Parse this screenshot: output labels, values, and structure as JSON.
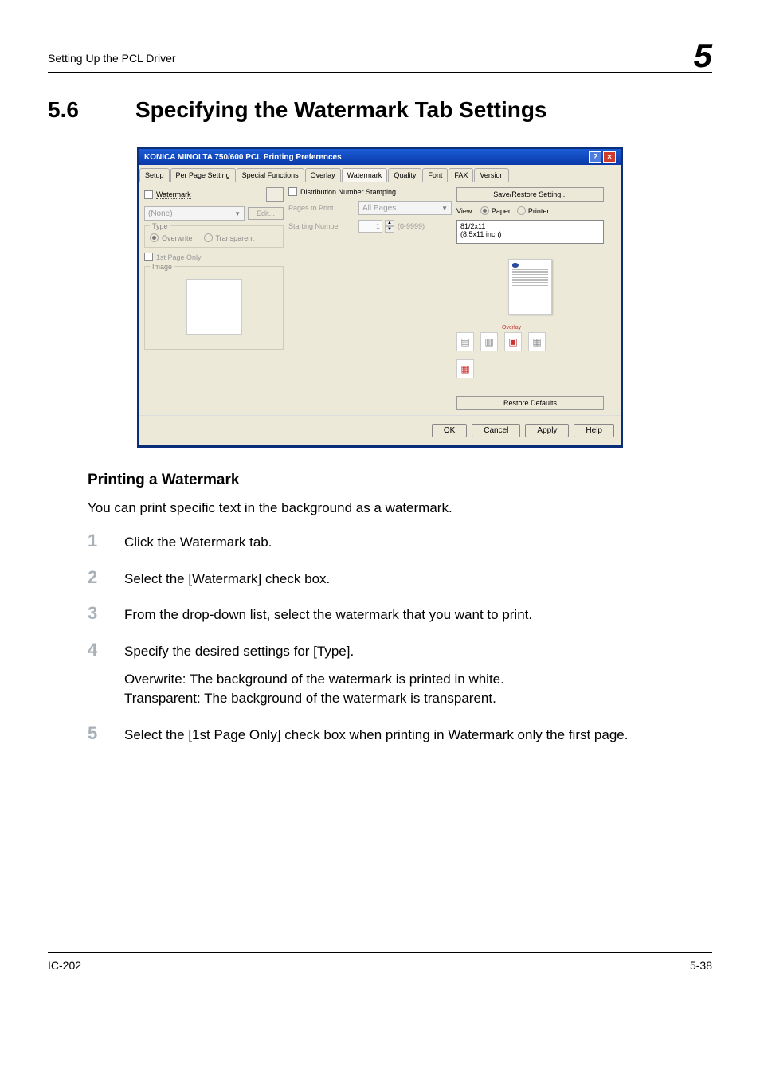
{
  "header": {
    "chapter_title": "Setting Up the PCL Driver",
    "chapter_num": "5"
  },
  "section": {
    "number": "5.6",
    "title": "Specifying the Watermark Tab Settings"
  },
  "dialog": {
    "title": "KONICA MINOLTA 750/600 PCL Printing Preferences",
    "tabs": [
      "Setup",
      "Per Page Setting",
      "Special Functions",
      "Overlay",
      "Watermark",
      "Quality",
      "Font",
      "FAX",
      "Version"
    ],
    "active_tab_index": 4,
    "left": {
      "watermark_label": "Watermark",
      "preset_value": "(None)",
      "edit_btn": "Edit...",
      "type_group": "Type",
      "overwrite_label": "Overwrite",
      "transparent_label": "Transparent",
      "first_page_label": "1st Page Only",
      "image_group": "Image"
    },
    "middle": {
      "dist_stamp_label": "Distribution Number Stamping",
      "pages_to_print_label": "Pages to Print",
      "pages_to_print_value": "All Pages",
      "starting_num_label": "Starting Number",
      "starting_num_value": "1",
      "starting_num_range": "(0-9999)"
    },
    "right": {
      "save_restore_btn": "Save/Restore Setting...",
      "view_label": "View:",
      "view_paper": "Paper",
      "view_printer": "Printer",
      "size_list": "81/2x11\n(8.5x11 inch)",
      "overlay_icon_label": "Overlay",
      "restore_btn": "Restore Defaults"
    },
    "bottom": {
      "ok": "OK",
      "cancel": "Cancel",
      "apply": "Apply",
      "help": "Help"
    }
  },
  "content": {
    "subheading": "Printing a Watermark",
    "lead": "You can print specific text in the background as a watermark.",
    "step1": "Click the Watermark tab.",
    "step2": "Select the [Watermark] check box.",
    "step3": "From the drop-down list, select the watermark that you want to print.",
    "step4_main": "Specify the desired settings for [Type].",
    "step4_sub1": "Overwrite: The background of the watermark is printed in white.",
    "step4_sub2": "Transparent: The background of the watermark is transparent.",
    "step5": "Select the [1st Page Only] check box when printing in Watermark only the first page."
  },
  "footer": {
    "left": "IC-202",
    "right": "5-38"
  }
}
